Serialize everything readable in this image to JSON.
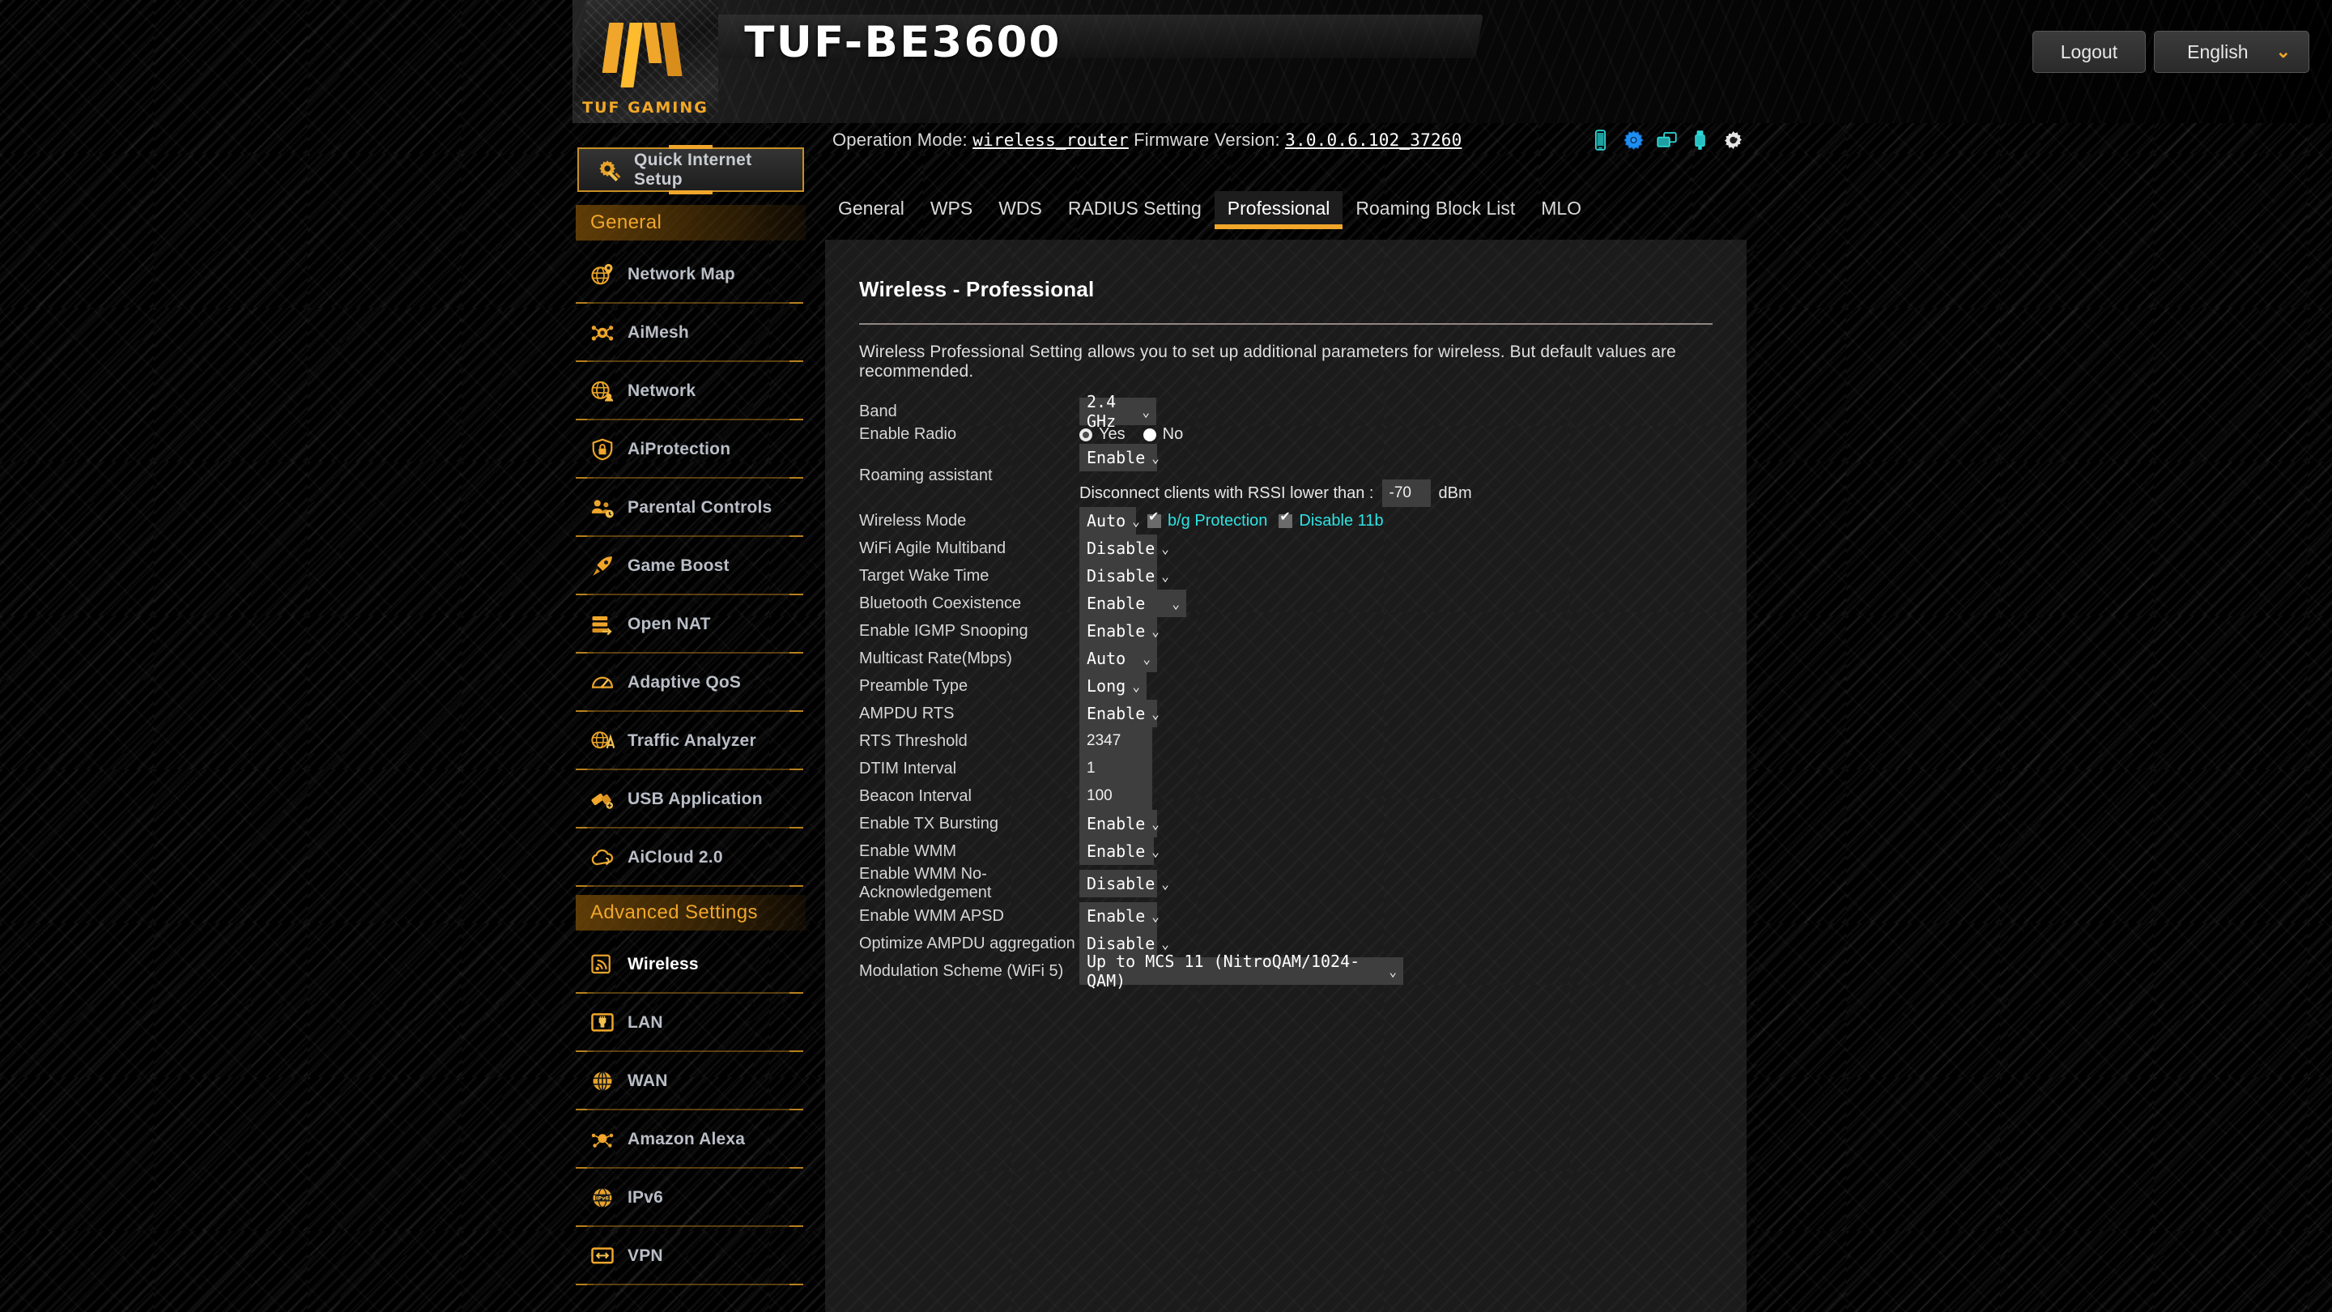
{
  "brand": {
    "logo_text": "TUF GAMING",
    "model": "TUF-BE3600"
  },
  "header": {
    "logout_label": "Logout",
    "language_label": "English",
    "language_caret": "⌄",
    "operation_mode_label": "Operation Mode:",
    "operation_mode_value": "wireless_router",
    "firmware_label": "Firmware Version:",
    "firmware_value": "3.0.0.6.102_37260",
    "status_icons": [
      {
        "name": "mobile-icon",
        "color": "#2fd8d8"
      },
      {
        "name": "settings-gear-icon",
        "color": "#1f8ef1"
      },
      {
        "name": "displays-icon",
        "color": "#2fd8d8"
      },
      {
        "name": "usb-icon",
        "color": "#2fd8d8"
      },
      {
        "name": "reboot-icon",
        "color": "#e6e6e6"
      }
    ]
  },
  "sidebar": {
    "quick_setup_label": "Quick Internet Setup",
    "general_header": "General",
    "advanced_header": "Advanced Settings",
    "general_items": [
      {
        "label": "Network Map",
        "icon": "network-map-icon"
      },
      {
        "label": "AiMesh",
        "icon": "aimesh-icon"
      },
      {
        "label": "Network",
        "icon": "network-icon"
      },
      {
        "label": "AiProtection",
        "icon": "shield-lock-icon"
      },
      {
        "label": "Parental Controls",
        "icon": "parental-controls-icon"
      },
      {
        "label": "Game Boost",
        "icon": "rocket-icon"
      },
      {
        "label": "Open NAT",
        "icon": "open-nat-icon"
      },
      {
        "label": "Adaptive QoS",
        "icon": "gauge-icon"
      },
      {
        "label": "Traffic Analyzer",
        "icon": "traffic-analyzer-icon"
      },
      {
        "label": "USB Application",
        "icon": "usb-application-icon"
      },
      {
        "label": "AiCloud 2.0",
        "icon": "cloud-icon"
      }
    ],
    "advanced_items": [
      {
        "label": "Wireless",
        "icon": "wireless-icon",
        "active": true
      },
      {
        "label": "LAN",
        "icon": "lan-icon"
      },
      {
        "label": "WAN",
        "icon": "wan-globe-icon"
      },
      {
        "label": "Amazon Alexa",
        "icon": "alexa-icon"
      },
      {
        "label": "IPv6",
        "icon": "ipv6-icon"
      },
      {
        "label": "VPN",
        "icon": "vpn-icon"
      }
    ]
  },
  "tabs": [
    {
      "label": "General",
      "active": false
    },
    {
      "label": "WPS",
      "active": false
    },
    {
      "label": "WDS",
      "active": false
    },
    {
      "label": "RADIUS Setting",
      "active": false
    },
    {
      "label": "Professional",
      "active": true
    },
    {
      "label": "Roaming Block List",
      "active": false
    },
    {
      "label": "MLO",
      "active": false
    }
  ],
  "page": {
    "title": "Wireless - Professional",
    "description": "Wireless Professional Setting allows you to set up additional parameters for wireless. But default values are recommended."
  },
  "form": {
    "band": {
      "label": "Band",
      "value": "2.4 GHz"
    },
    "enable_radio": {
      "label": "Enable Radio",
      "yes_label": "Yes",
      "no_label": "No",
      "selected": "Yes"
    },
    "roaming_assistant": {
      "label": "Roaming assistant",
      "value": "Enable",
      "sub_label": "Disconnect clients with RSSI lower than :",
      "rssi_value": "-70",
      "unit": "dBm"
    },
    "wireless_mode": {
      "label": "Wireless Mode",
      "value": "Auto",
      "bg_protection_label": "b/g Protection",
      "bg_protection_checked": true,
      "disable_11b_label": "Disable 11b",
      "disable_11b_checked": true
    },
    "wifi_agile_multiband": {
      "label": "WiFi Agile Multiband",
      "value": "Disable"
    },
    "target_wake_time": {
      "label": "Target Wake Time",
      "value": "Disable"
    },
    "bluetooth_coexistence": {
      "label": "Bluetooth Coexistence",
      "value": "Enable"
    },
    "igmp_snooping": {
      "label": "Enable IGMP Snooping",
      "value": "Enable"
    },
    "multicast_rate": {
      "label": "Multicast Rate(Mbps)",
      "value": "Auto"
    },
    "preamble_type": {
      "label": "Preamble Type",
      "value": "Long"
    },
    "ampdu_rts": {
      "label": "AMPDU RTS",
      "value": "Enable"
    },
    "rts_threshold": {
      "label": "RTS Threshold",
      "value": "2347"
    },
    "dtim_interval": {
      "label": "DTIM Interval",
      "value": "1"
    },
    "beacon_interval": {
      "label": "Beacon Interval",
      "value": "100"
    },
    "tx_bursting": {
      "label": "Enable TX Bursting",
      "value": "Enable"
    },
    "wmm": {
      "label": "Enable WMM",
      "value": "Enable"
    },
    "wmm_no_ack": {
      "label": "Enable WMM No-Acknowledgement",
      "value": "Disable"
    },
    "wmm_apsd": {
      "label": "Enable WMM APSD",
      "value": "Enable"
    },
    "optimize_ampdu": {
      "label": "Optimize AMPDU aggregation",
      "value": "Disable"
    },
    "modulation_scheme": {
      "label": "Modulation Scheme (WiFi 5)",
      "value": "Up to MCS 11 (NitroQAM/1024-QAM)"
    },
    "caret": "⌄"
  },
  "colors": {
    "accent_orange": "#f0a62a",
    "cyan": "#2fe3e3",
    "panel_bg": "#1b1b1b",
    "control_bg": "#3e3e3e"
  }
}
